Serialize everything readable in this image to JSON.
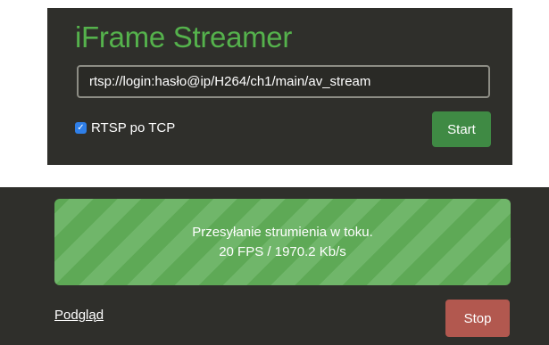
{
  "app": {
    "title": "iFrame Streamer",
    "colors": {
      "panel_bg": "#2f2f2b",
      "title_green": "#55b24c",
      "start_green": "#3f8a44",
      "status_stripe_dark": "#5ea956",
      "status_stripe_light": "#70b66a",
      "stop_red": "#b2584f",
      "checkbox_blue": "#2f7fe8"
    }
  },
  "setup": {
    "url_value": "rtsp://login:hasło@ip/H264/ch1/main/av_stream",
    "tcp_label": "RTSP po TCP",
    "tcp_checked": true,
    "tcp_check_glyph": "✓",
    "start_label": "Start"
  },
  "stream": {
    "status_line1": "Przesyłanie strumienia w toku.",
    "status_line2": "20 FPS / 1970.2 Kb/s",
    "preview_label": "Podgląd",
    "stop_label": "Stop"
  }
}
